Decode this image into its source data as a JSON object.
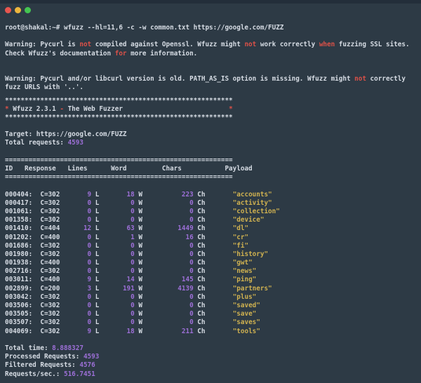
{
  "colors": {
    "background": "#2d3a45",
    "top_edge": "#232e3a",
    "foreground": "#d6dce4",
    "red": "#dc5148",
    "purple": "#9c6fd6",
    "yellow": "#cfb150"
  },
  "window": {
    "controls": [
      {
        "name": "close",
        "color": "#e8564f"
      },
      {
        "name": "minimize",
        "color": "#edb63e"
      },
      {
        "name": "maximize",
        "color": "#44c551"
      }
    ]
  },
  "terminal": {
    "prompt_line": {
      "prompt": "root@shakal:~#",
      "command": "wfuzz --hl=11,6 -c -w common.txt https://google.com/FUZZ"
    },
    "warning1": {
      "lines": [
        [
          {
            "t": "Warning: Pycurl is ",
            "c": "fg"
          },
          {
            "t": "not",
            "c": "red"
          },
          {
            "t": " compiled against Openssl. Wfuzz might ",
            "c": "fg"
          },
          {
            "t": "not",
            "c": "red"
          },
          {
            "t": " work correctly ",
            "c": "fg"
          },
          {
            "t": "when",
            "c": "red"
          },
          {
            "t": " fuzzing SSL sites.",
            "c": "fg"
          }
        ],
        [
          {
            "t": "Check Wfuzz's documentation ",
            "c": "fg"
          },
          {
            "t": "for",
            "c": "red"
          },
          {
            "t": " more information.",
            "c": "fg"
          }
        ]
      ]
    },
    "warning2": {
      "lines": [
        [
          {
            "t": "Warning: Pycurl and/or libcurl version is old. PATH_AS_IS option is missing. Wfuzz might ",
            "c": "fg"
          },
          {
            "t": "not",
            "c": "red"
          },
          {
            "t": " correctly",
            "c": "fg"
          }
        ],
        [
          {
            "t": "fuzz URLS with '..'.",
            "c": "fg"
          }
        ]
      ]
    },
    "banner": {
      "border": "**********************************************************",
      "title": [
        {
          "t": "*",
          "c": "red"
        },
        {
          "t": " Wfuzz 2.3.1 ",
          "c": "fg"
        },
        {
          "t": "-",
          "c": "red"
        },
        {
          "t": " The Web Fuzzer",
          "c": "fg"
        },
        {
          "t": "                           ",
          "c": "fg"
        },
        {
          "t": "*",
          "c": "red"
        }
      ]
    },
    "target": {
      "label": "Target: ",
      "value": "https://google.com/FUZZ",
      "value_color": "fg"
    },
    "total_requests": {
      "label": "Total requests: ",
      "value": "4593",
      "value_color": "purple"
    },
    "table": {
      "separator": "==========================================================",
      "headers": [
        "ID",
        "Response",
        "Lines",
        "Word",
        "Chars",
        "Payload"
      ],
      "unit_labels": {
        "lines": " L",
        "word": " W",
        "chars": " Ch"
      },
      "rows": [
        {
          "id": "000404:",
          "response": "C=302",
          "lines": "9",
          "word": "18",
          "chars": "223",
          "payload": "\"accounts\""
        },
        {
          "id": "000417:",
          "response": "C=302",
          "lines": "0",
          "word": "0",
          "chars": "0",
          "payload": "\"activity\""
        },
        {
          "id": "001061:",
          "response": "C=302",
          "lines": "0",
          "word": "0",
          "chars": "0",
          "payload": "\"collection\""
        },
        {
          "id": "001358:",
          "response": "C=302",
          "lines": "0",
          "word": "0",
          "chars": "0",
          "payload": "\"device\""
        },
        {
          "id": "001410:",
          "response": "C=404",
          "lines": "12",
          "word": "63",
          "chars": "1449",
          "payload": "\"dl\""
        },
        {
          "id": "001202:",
          "response": "C=400",
          "lines": "0",
          "word": "1",
          "chars": "16",
          "payload": "\"cr\""
        },
        {
          "id": "001686:",
          "response": "C=302",
          "lines": "0",
          "word": "0",
          "chars": "0",
          "payload": "\"fi\""
        },
        {
          "id": "001980:",
          "response": "C=302",
          "lines": "0",
          "word": "0",
          "chars": "0",
          "payload": "\"history\""
        },
        {
          "id": "001938:",
          "response": "C=400",
          "lines": "0",
          "word": "0",
          "chars": "0",
          "payload": "\"gwt\""
        },
        {
          "id": "002716:",
          "response": "C=302",
          "lines": "0",
          "word": "0",
          "chars": "0",
          "payload": "\"news\""
        },
        {
          "id": "003011:",
          "response": "C=400",
          "lines": "9",
          "word": "14",
          "chars": "145",
          "payload": "\"ping\""
        },
        {
          "id": "002899:",
          "response": "C=200",
          "lines": "3",
          "word": "191",
          "chars": "4139",
          "payload": "\"partners\""
        },
        {
          "id": "003042:",
          "response": "C=302",
          "lines": "0",
          "word": "0",
          "chars": "0",
          "payload": "\"plus\""
        },
        {
          "id": "003506:",
          "response": "C=302",
          "lines": "0",
          "word": "0",
          "chars": "0",
          "payload": "\"saved\""
        },
        {
          "id": "003505:",
          "response": "C=302",
          "lines": "0",
          "word": "0",
          "chars": "0",
          "payload": "\"save\""
        },
        {
          "id": "003507:",
          "response": "C=302",
          "lines": "0",
          "word": "0",
          "chars": "0",
          "payload": "\"saves\""
        },
        {
          "id": "004069:",
          "response": "C=302",
          "lines": "9",
          "word": "18",
          "chars": "211",
          "payload": "\"tools\""
        }
      ]
    },
    "footer": [
      {
        "label": "Total time: ",
        "value": "8.888327"
      },
      {
        "label": "Processed Requests: ",
        "value": "4593"
      },
      {
        "label": "Filtered Requests: ",
        "value": "4576"
      },
      {
        "label": "Requests/sec.: ",
        "value": "516.7451"
      }
    ]
  }
}
